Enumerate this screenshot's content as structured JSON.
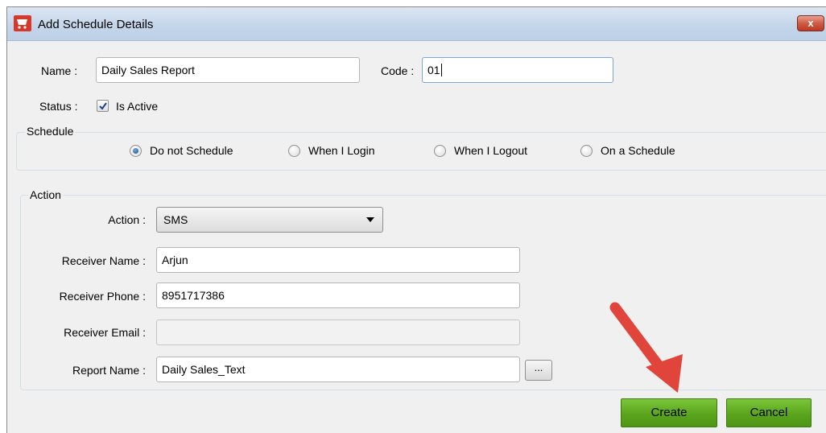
{
  "window": {
    "title": "Add Schedule Details",
    "close_label": "x"
  },
  "form": {
    "name_label": "Name :",
    "name_value": "Daily Sales Report",
    "code_label": "Code :",
    "code_value": "01",
    "status_label": "Status :",
    "is_active_label": "Is Active",
    "is_active_checked": true
  },
  "schedule": {
    "title": "Schedule",
    "options": [
      {
        "label": "Do not Schedule",
        "checked": true
      },
      {
        "label": "When I Login",
        "checked": false
      },
      {
        "label": "When I Logout",
        "checked": false
      },
      {
        "label": "On a Schedule",
        "checked": false
      }
    ]
  },
  "action": {
    "title": "Action",
    "action_label": "Action :",
    "action_value": "SMS",
    "receiver_name_label": "Receiver Name :",
    "receiver_name_value": "Arjun",
    "receiver_phone_label": "Receiver Phone :",
    "receiver_phone_value": "8951717386",
    "receiver_email_label": "Receiver Email :",
    "receiver_email_value": "",
    "report_name_label": "Report Name :",
    "report_name_value": "Daily Sales_Text",
    "browse_label": "..."
  },
  "buttons": {
    "create_label": "Create",
    "cancel_label": "Cancel"
  },
  "colors": {
    "button_green": "#5aa51c",
    "annotation_arrow": "#e0443a",
    "titlebar": "#c5d6ea"
  },
  "icons": {
    "window_icon": "shopping-cart-icon"
  }
}
